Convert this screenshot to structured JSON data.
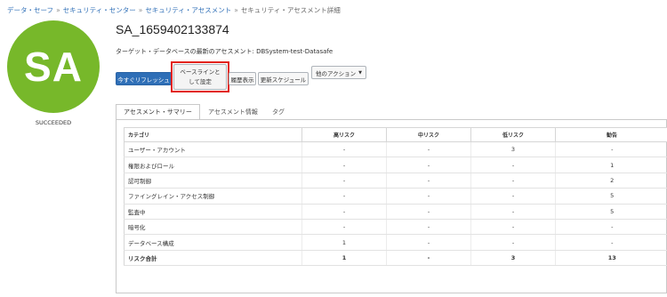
{
  "breadcrumb": {
    "items": [
      "データ・セーフ",
      "セキュリティ・センター",
      "セキュリティ・アセスメント"
    ],
    "separator": "»",
    "current": "セキュリティ・アセスメント詳細"
  },
  "avatar": {
    "initials": "SA",
    "status": "SUCCEEDED",
    "color": "#77b82a"
  },
  "title": "SA_1659402133874",
  "latest_assessment": "ターゲット・データベースの最新のアセスメント: DBSystem-test-Datasafe",
  "toolbar": {
    "refresh_label": "今すぐリフレッシュ",
    "baseline_line1": "ベースラインと",
    "baseline_line2": "して設定",
    "history_label": "履歴表示",
    "schedule_label": "更新スケジュール",
    "more_actions_label": "他のアクション",
    "caret": "▼"
  },
  "tabs": [
    {
      "label": "アセスメント・サマリー",
      "active": true
    },
    {
      "label": "アセスメント情報",
      "active": false
    },
    {
      "label": "タグ",
      "active": false
    }
  ],
  "table": {
    "headers": [
      "カテゴリ",
      "高リスク",
      "中リスク",
      "低リスク",
      "勧告"
    ],
    "rows": [
      [
        "ユーザー・アカウント",
        "-",
        "-",
        "3",
        "-"
      ],
      [
        "権限およびロール",
        "-",
        "-",
        "-",
        "1"
      ],
      [
        "認可制御",
        "-",
        "-",
        "-",
        "2"
      ],
      [
        "ファイングレイン・アクセス制御",
        "-",
        "-",
        "-",
        "5"
      ],
      [
        "監査中",
        "-",
        "-",
        "-",
        "5"
      ],
      [
        "暗号化",
        "-",
        "-",
        "-",
        "-"
      ],
      [
        "データベース構成",
        "1",
        "-",
        "-",
        "-"
      ]
    ],
    "total": [
      "リスク合計",
      "1",
      "-",
      "3",
      "13"
    ]
  },
  "colors": {
    "accent": "#2f6fb7",
    "highlight": "#e2231a",
    "avatar": "#77b82a"
  }
}
